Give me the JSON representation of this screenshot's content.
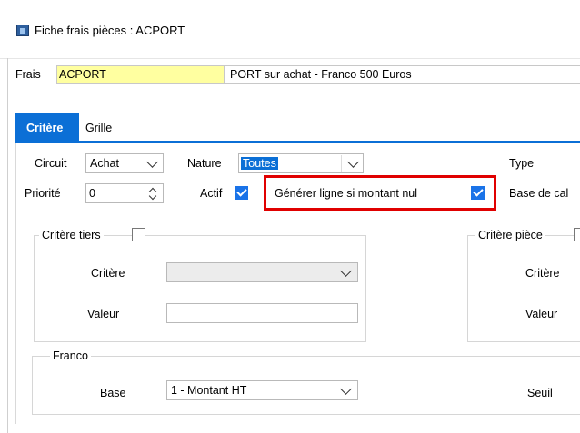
{
  "window": {
    "title": "Fiche frais pièces : ACPORT",
    "icon": "app-icon"
  },
  "frais": {
    "label": "Frais",
    "code": "ACPORT",
    "description": "PORT sur achat - Franco 500 Euros"
  },
  "tabs": [
    {
      "label": "Critère",
      "active": true
    },
    {
      "label": "Grille",
      "active": false
    }
  ],
  "row1": {
    "circuit_label": "Circuit",
    "circuit_value": "Achat",
    "nature_label": "Nature",
    "nature_value": "Toutes",
    "type_label": "Type"
  },
  "row2": {
    "priorite_label": "Priorité",
    "priorite_value": "0",
    "actif_label": "Actif",
    "actif_checked": true,
    "generer_label": "Générer ligne si montant nul",
    "generer_checked": true,
    "base_calc_label": "Base de cal"
  },
  "critere_tiers": {
    "title": "Critère tiers",
    "checked": false,
    "critere_label": "Critère",
    "valeur_label": "Valeur",
    "critere_value": "",
    "valeur_value": ""
  },
  "critere_piece": {
    "title": "Critère pièce",
    "critere_label": "Critère",
    "valeur_label": "Valeur"
  },
  "franco": {
    "title": "Franco",
    "base_label": "Base",
    "base_value": "1 - Montant HT",
    "seuil_label": "Seuil"
  },
  "colors": {
    "accent": "#0b6fd6",
    "highlight": "#e00000",
    "code_field_bg": "#ffffa0"
  }
}
